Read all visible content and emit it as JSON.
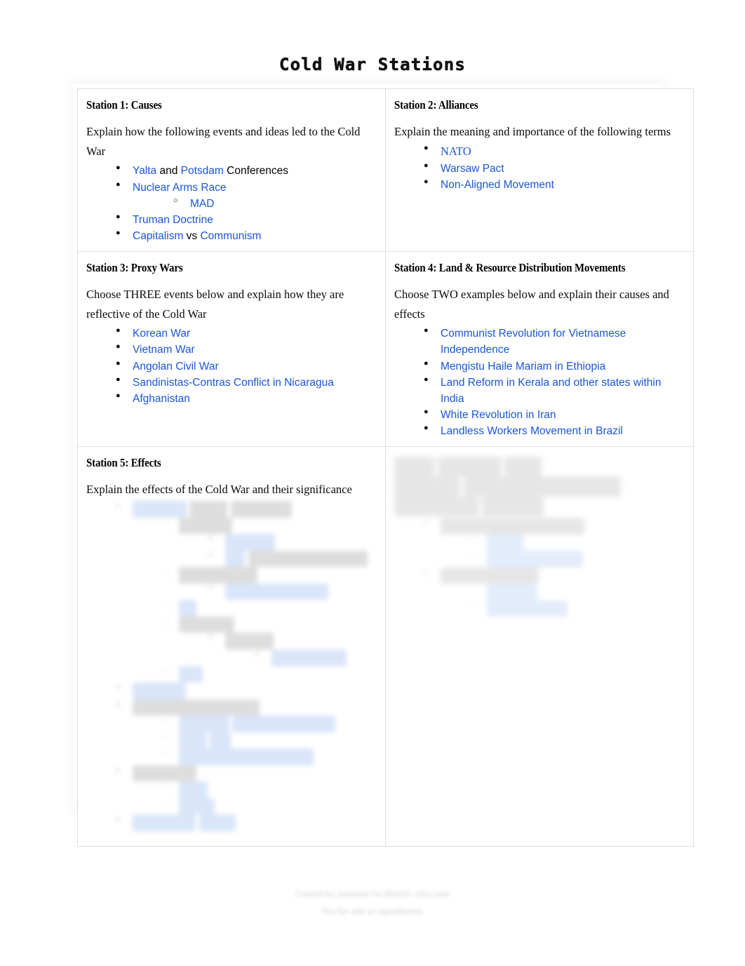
{
  "document": {
    "title": "Cold War Stations"
  },
  "stations": [
    {
      "heading": "Station 1: Causes",
      "prompt": "Explain how the following events and ideas led to the Cold War",
      "items": [
        {
          "parts": [
            {
              "t": "Yalta",
              "link": true
            },
            {
              "t": " and ",
              "link": false
            },
            {
              "t": "Potsdam",
              "link": true
            },
            {
              "t": " Conferences",
              "link": false
            }
          ]
        },
        {
          "parts": [
            {
              "t": "Nuclear Arms Race",
              "link": true
            }
          ],
          "children": [
            {
              "parts": [
                {
                  "t": "MAD",
                  "link": true
                }
              ]
            }
          ]
        },
        {
          "parts": [
            {
              "t": "Truman Doctrine",
              "link": true
            }
          ]
        },
        {
          "parts": [
            {
              "t": "Capitalism",
              "link": true
            },
            {
              "t": " vs ",
              "link": false
            },
            {
              "t": "Communism",
              "link": true
            }
          ]
        }
      ]
    },
    {
      "heading": "Station 2: Alliances",
      "prompt": "Explain the meaning and importance of the following terms",
      "items": [
        {
          "parts": [
            {
              "t": "NATO",
              "link": true,
              "serif": true
            }
          ]
        },
        {
          "parts": [
            {
              "t": "Warsaw Pact",
              "link": true
            }
          ]
        },
        {
          "parts": [
            {
              "t": "Non-Aligned Movement",
              "link": true
            }
          ]
        }
      ]
    },
    {
      "heading": "Station 3: Proxy Wars",
      "prompt": "Choose THREE events below and explain how they are reflective of the Cold War",
      "items": [
        {
          "parts": [
            {
              "t": "Korean War",
              "link": true
            }
          ]
        },
        {
          "parts": [
            {
              "t": "Vietnam War",
              "link": true
            }
          ]
        },
        {
          "parts": [
            {
              "t": "Angolan Civil War",
              "link": true
            }
          ]
        },
        {
          "parts": [
            {
              "t": "Sandinistas-Contras Conflict in Nicaragua",
              "link": true
            }
          ]
        },
        {
          "parts": [
            {
              "t": "Afghanistan",
              "link": true
            }
          ]
        }
      ]
    },
    {
      "heading": "Station 4: Land & Resource Distribution Movements",
      "prompt": "Choose TWO examples below and explain their causes and effects",
      "items": [
        {
          "parts": [
            {
              "t": "Communist Revolution for Vietnamese Independence",
              "link": true
            }
          ]
        },
        {
          "parts": [
            {
              "t": "Mengistu Haile Mariam in Ethiopia",
              "link": true
            }
          ]
        },
        {
          "parts": [
            {
              "t": "Land Reform in Kerala and other states within India",
              "link": true
            }
          ]
        },
        {
          "parts": [
            {
              "t": "White Revolution in Iran",
              "link": true
            }
          ]
        },
        {
          "parts": [
            {
              "t": "Landless Workers Movement in Brazil",
              "link": true
            }
          ]
        }
      ]
    },
    {
      "heading": "Station 5: Effects",
      "prompt": "Explain the effects of the Cold War and their significance",
      "redacted": true,
      "redacted_note": "list content is blurred / illegible in the source image"
    }
  ],
  "station5_right": {
    "redacted": true,
    "redacted_note": "cell content is blurred / illegible in the source image"
  },
  "footer": {
    "line1": "",
    "line2": "",
    "redacted": true,
    "redacted_note": "two blurred lines of small attribution text at page bottom"
  }
}
